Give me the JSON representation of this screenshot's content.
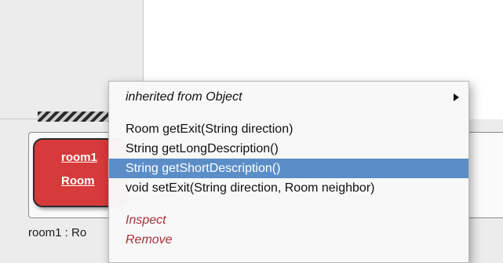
{
  "object_bench": {
    "instance_name": "room1",
    "instance_type": "Room",
    "status": "room1 : Ro"
  },
  "context_menu": {
    "inherited_label": "inherited from Object",
    "methods": [
      "Room getExit(String direction)",
      "String getLongDescription()",
      "String getShortDescription()",
      "void setExit(String direction, Room neighbor)"
    ],
    "selected_index": 2,
    "actions": [
      "Inspect",
      "Remove"
    ]
  },
  "colors": {
    "object_card": "#d73a3a",
    "selection": "#5b8ec7",
    "action_text": "#a8323a"
  },
  "icons": {
    "submenu": "triangle-right-icon"
  }
}
